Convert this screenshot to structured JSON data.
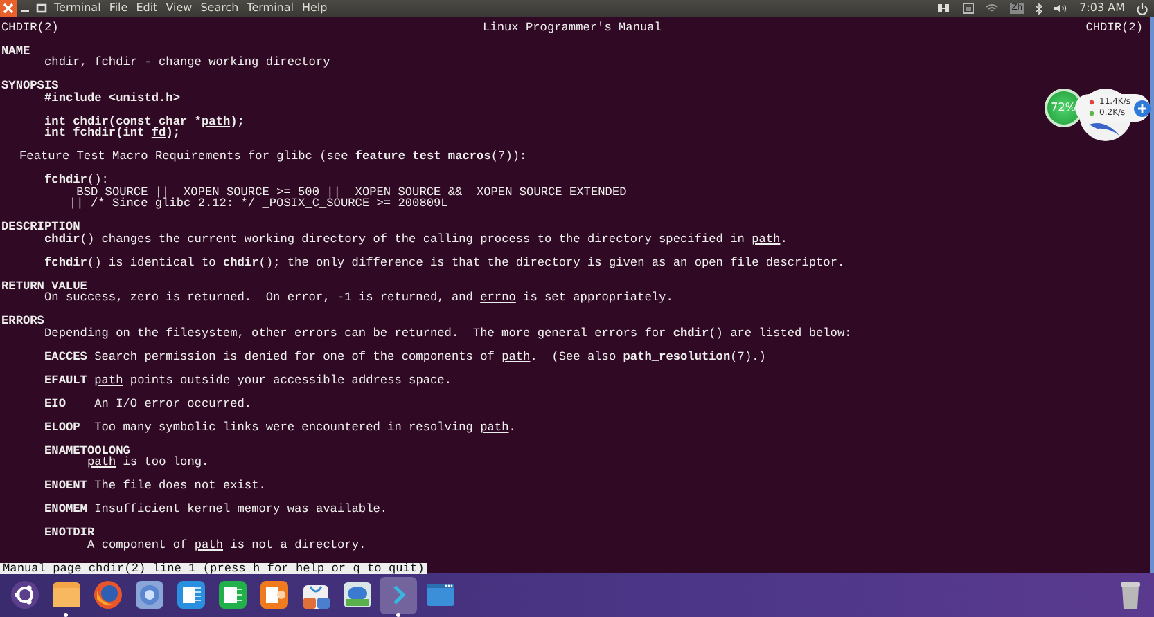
{
  "top_panel": {
    "menu": [
      "Terminal",
      "File",
      "Edit",
      "View",
      "Search",
      "Terminal",
      "Help"
    ],
    "keyboard": "Zh",
    "clock": "7:03 AM"
  },
  "man_header": {
    "left": "CHDIR(2)",
    "center": "Linux Programmer's Manual",
    "right": "CHDIR(2)"
  },
  "man_sections": [
    {
      "heading": "NAME",
      "paragraphs": [
        [
          {
            "kind": "body",
            "parts": [
              "chdir, fchdir - change working directory"
            ]
          }
        ]
      ]
    },
    {
      "heading": "SYNOPSIS",
      "paragraphs": [
        [
          {
            "kind": "code",
            "parts": [
              "#include <unistd.h>"
            ]
          }
        ],
        [
          {
            "kind": "code",
            "parts": [
              "int chdir(const char *",
              "*path*",
              ");"
            ]
          },
          {
            "kind": "code",
            "parts": [
              "int fchdir(int *fd*);"
            ]
          }
        ],
        [
          {
            "kind": "feature",
            "parts": [
              "Feature Test Macro Requirements for glibc (see **feature_test_macros**(7)):"
            ]
          }
        ],
        [
          {
            "kind": "body",
            "parts": [
              "**fchdir**():"
            ]
          },
          {
            "kind": "macro",
            "parts": [
              "_BSD_SOURCE || _XOPEN_SOURCE >= 500 || _XOPEN_SOURCE && _XOPEN_SOURCE_EXTENDED"
            ]
          },
          {
            "kind": "macro",
            "parts": [
              "|| /",
              "* Since glibc 2.12: *",
              "/ _POSIX_C_SOURCE >= 200809L"
            ]
          }
        ]
      ]
    },
    {
      "heading": "DESCRIPTION",
      "paragraphs": [
        [
          {
            "kind": "body",
            "parts": [
              "**chdir**() changes the current working directory of the calling process to the directory specified in *path*."
            ]
          }
        ],
        [
          {
            "kind": "body",
            "parts": [
              "**fchdir**() is identical to **chdir**(); the only difference is that the directory is given as an open file descriptor."
            ]
          }
        ]
      ]
    },
    {
      "heading": "RETURN VALUE",
      "paragraphs": [
        [
          {
            "kind": "body",
            "parts": [
              "On success, zero is returned.  On error, -1 is returned, and *errno* is set appropriately."
            ]
          }
        ]
      ]
    },
    {
      "heading": "ERRORS",
      "paragraphs": [
        [
          {
            "kind": "body",
            "parts": [
              "Depending on the filesystem, other errors can be returned.  The more general errors for **chdir**() are listed below:"
            ]
          }
        ],
        [
          {
            "kind": "body",
            "parts": [
              "**EACCES** Search permission is denied for one of the components of *path*.  (See also **path_resolution**(7).)"
            ]
          }
        ],
        [
          {
            "kind": "body",
            "parts": [
              "**EFAULT** *path* points outside your accessible address space."
            ]
          }
        ],
        [
          {
            "kind": "body",
            "parts": [
              "**EIO**    An I/O error occurred."
            ]
          }
        ],
        [
          {
            "kind": "body",
            "parts": [
              "**ELOOP**  Too many symbolic links were encountered in resolving *path*."
            ]
          }
        ],
        [
          {
            "kind": "code",
            "parts": [
              "ENAMETOOLONG"
            ]
          },
          {
            "kind": "sub",
            "parts": [
              "*path* is too long."
            ]
          }
        ],
        [
          {
            "kind": "body",
            "parts": [
              "**ENOENT** The file does not exist."
            ]
          }
        ],
        [
          {
            "kind": "body",
            "parts": [
              "**ENOMEM** Insufficient kernel memory was available."
            ]
          }
        ],
        [
          {
            "kind": "code",
            "parts": [
              "ENOTDIR"
            ]
          },
          {
            "kind": "sub",
            "parts": [
              "A component of *path* is not a directory."
            ]
          }
        ]
      ]
    }
  ],
  "status_line": "Manual page chdir(2) line 1 (press h for help or q to quit)",
  "net_widget": {
    "usage": "72%",
    "upload": "11.4K/s",
    "download": "0.2K/s"
  },
  "dock": [
    {
      "kind": "ubuntu",
      "running": false,
      "focused": false
    },
    {
      "kind": "folder",
      "running": true,
      "focused": false
    },
    {
      "kind": "firefox",
      "running": false,
      "focused": false
    },
    {
      "kind": "chromium",
      "running": false,
      "focused": false
    },
    {
      "kind": "writer",
      "running": false,
      "focused": false
    },
    {
      "kind": "sheet",
      "running": false,
      "focused": false
    },
    {
      "kind": "slides",
      "running": false,
      "focused": false
    },
    {
      "kind": "bag",
      "running": false,
      "focused": false
    },
    {
      "kind": "mail",
      "running": false,
      "focused": false
    },
    {
      "kind": "terminal",
      "running": true,
      "focused": true
    },
    {
      "kind": "window",
      "running": false,
      "focused": false
    }
  ]
}
